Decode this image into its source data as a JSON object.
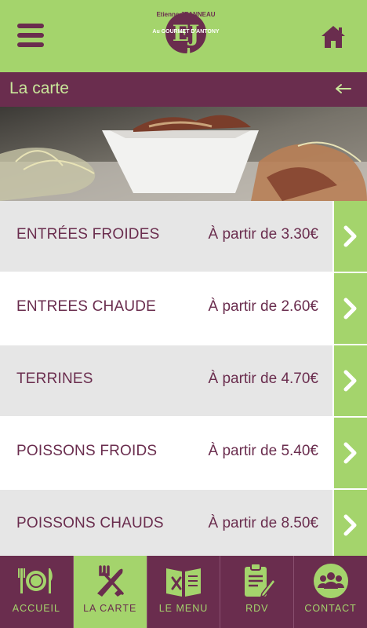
{
  "header": {
    "logo_initials": "EJ",
    "logo_name": "Etienne JEANNEAU",
    "logo_subtitle": "Au GOURMET D'ANTONY"
  },
  "titlebar": {
    "title": "La carte"
  },
  "menu_items": [
    {
      "name": "ENTRÉES FROIDES",
      "price": "À partir de 3.30€"
    },
    {
      "name": "ENTREES CHAUDE",
      "price": "À partir de 2.60€"
    },
    {
      "name": "TERRINES",
      "price": "À partir de 4.70€"
    },
    {
      "name": "POISSONS FROIDS",
      "price": "À partir de 5.40€"
    },
    {
      "name": "POISSONS CHAUDS",
      "price": "À partir de 8.50€"
    }
  ],
  "tabs": [
    {
      "label": "ACCUEIL",
      "icon": "plate-cutlery-icon"
    },
    {
      "label": "LA CARTE",
      "icon": "fork-knife-icon",
      "active": true
    },
    {
      "label": "LE MENU",
      "icon": "menu-book-icon"
    },
    {
      "label": "RDV",
      "icon": "clipboard-icon"
    },
    {
      "label": "CONTACT",
      "icon": "contact-group-icon"
    }
  ],
  "colors": {
    "green": "#a4d46c",
    "plum": "#6a2d4e",
    "light_green_text": "#c9e69a",
    "row_grey": "#e6e6e6"
  }
}
